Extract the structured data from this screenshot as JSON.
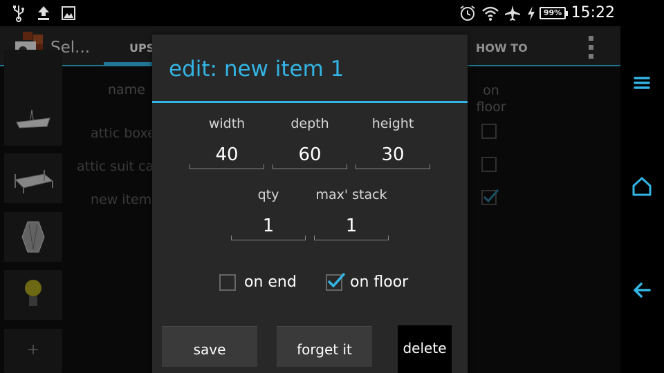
{
  "status_bar": {
    "battery": "99%",
    "time": "15:22",
    "icons": [
      "usb-icon",
      "upload-icon",
      "image-icon",
      "alarm-clock-icon",
      "wifi-icon",
      "airplane-icon",
      "charging-icon"
    ]
  },
  "action_bar": {
    "title": "Sel...",
    "tabs": [
      {
        "label": "UPS"
      },
      {
        "label": "HOW TO"
      }
    ]
  },
  "list": {
    "header_name": "name",
    "header_on_floor": "on floor",
    "items": [
      {
        "name": "attic boxe",
        "on_floor": false
      },
      {
        "name": "attic suit ca",
        "on_floor": false
      },
      {
        "name": "new item",
        "on_floor": true
      }
    ],
    "add_label": "+"
  },
  "dialog": {
    "title": "edit: new item 1",
    "width_label": "width",
    "width_value": "40",
    "depth_label": "depth",
    "depth_value": "60",
    "height_label": "height",
    "height_value": "30",
    "qty_label": "qty",
    "qty_value": "1",
    "max_stack_label": "max' stack",
    "max_stack_value": "1",
    "on_end_label": "on end",
    "on_end_checked": false,
    "on_floor_label": "on floor",
    "on_floor_checked": true,
    "save_label": "save",
    "forget_label": "forget it",
    "delete_label": "delete"
  },
  "colors": {
    "accent": "#33b5e5",
    "dialog_bg": "#282828",
    "action_bar_bg": "#262626"
  }
}
